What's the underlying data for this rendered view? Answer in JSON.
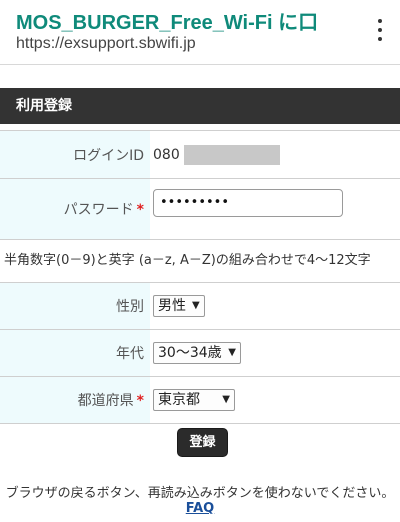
{
  "browser": {
    "title": "MOS_BURGER_Free_Wi-Fi に口",
    "url": "https://exsupport.sbwifi.jp"
  },
  "section": {
    "title": "利用登録"
  },
  "form": {
    "login_id_label": "ログインID",
    "login_id_prefix": "080",
    "password_label": "パスワード",
    "password_value": "•••••••••",
    "required_mark": "*",
    "password_hint": "半角数字(0－9)と英字 (a－z, A－Z)の組み合わせで4～12文字",
    "gender_label": "性別",
    "gender_value": "男性",
    "age_label": "年代",
    "age_value": "30～34歳",
    "prefecture_label": "都道府県",
    "prefecture_value": "東京都",
    "submit_label": "登録"
  },
  "footer": {
    "note": "ブラウザの戻るボタン、再読み込みボタンを使わないでください。",
    "faq_label": "FAQ"
  }
}
